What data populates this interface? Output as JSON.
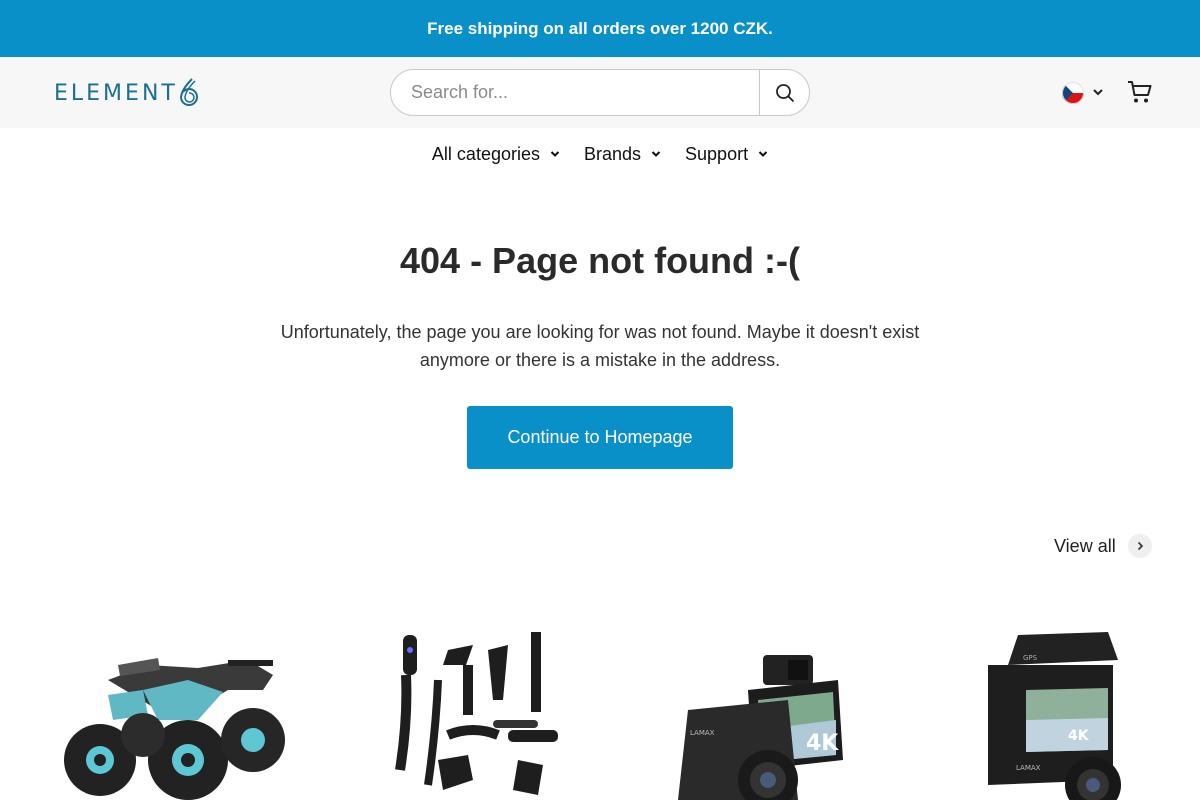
{
  "announcement": {
    "text": "Free shipping on all orders over 1200 CZK."
  },
  "header": {
    "logo_text": "ELEMENT",
    "search": {
      "placeholder": "Search for...",
      "value": ""
    },
    "country_flag": "czech-flag-icon",
    "cart_icon": "cart-icon"
  },
  "nav": {
    "items": [
      {
        "label": "All categories"
      },
      {
        "label": "Brands"
      },
      {
        "label": "Support"
      }
    ]
  },
  "main": {
    "title": "404 - Page not found :-(",
    "description": "Unfortunately, the page you are looking for was not found. Maybe it doesn't exist anymore or there is a mistake in the address.",
    "cta_label": "Continue to Homepage"
  },
  "products": {
    "view_all_label": "View all",
    "items": [
      {
        "image": "quad-atv-image"
      },
      {
        "image": "vacuum-accessories-image"
      },
      {
        "image": "dashcam-4k-image"
      },
      {
        "image": "dashcam-4k-gps-image"
      }
    ]
  },
  "colors": {
    "accent": "#0a90c8",
    "header_bg": "#f7f7f7",
    "logo": "#1b6f93"
  }
}
